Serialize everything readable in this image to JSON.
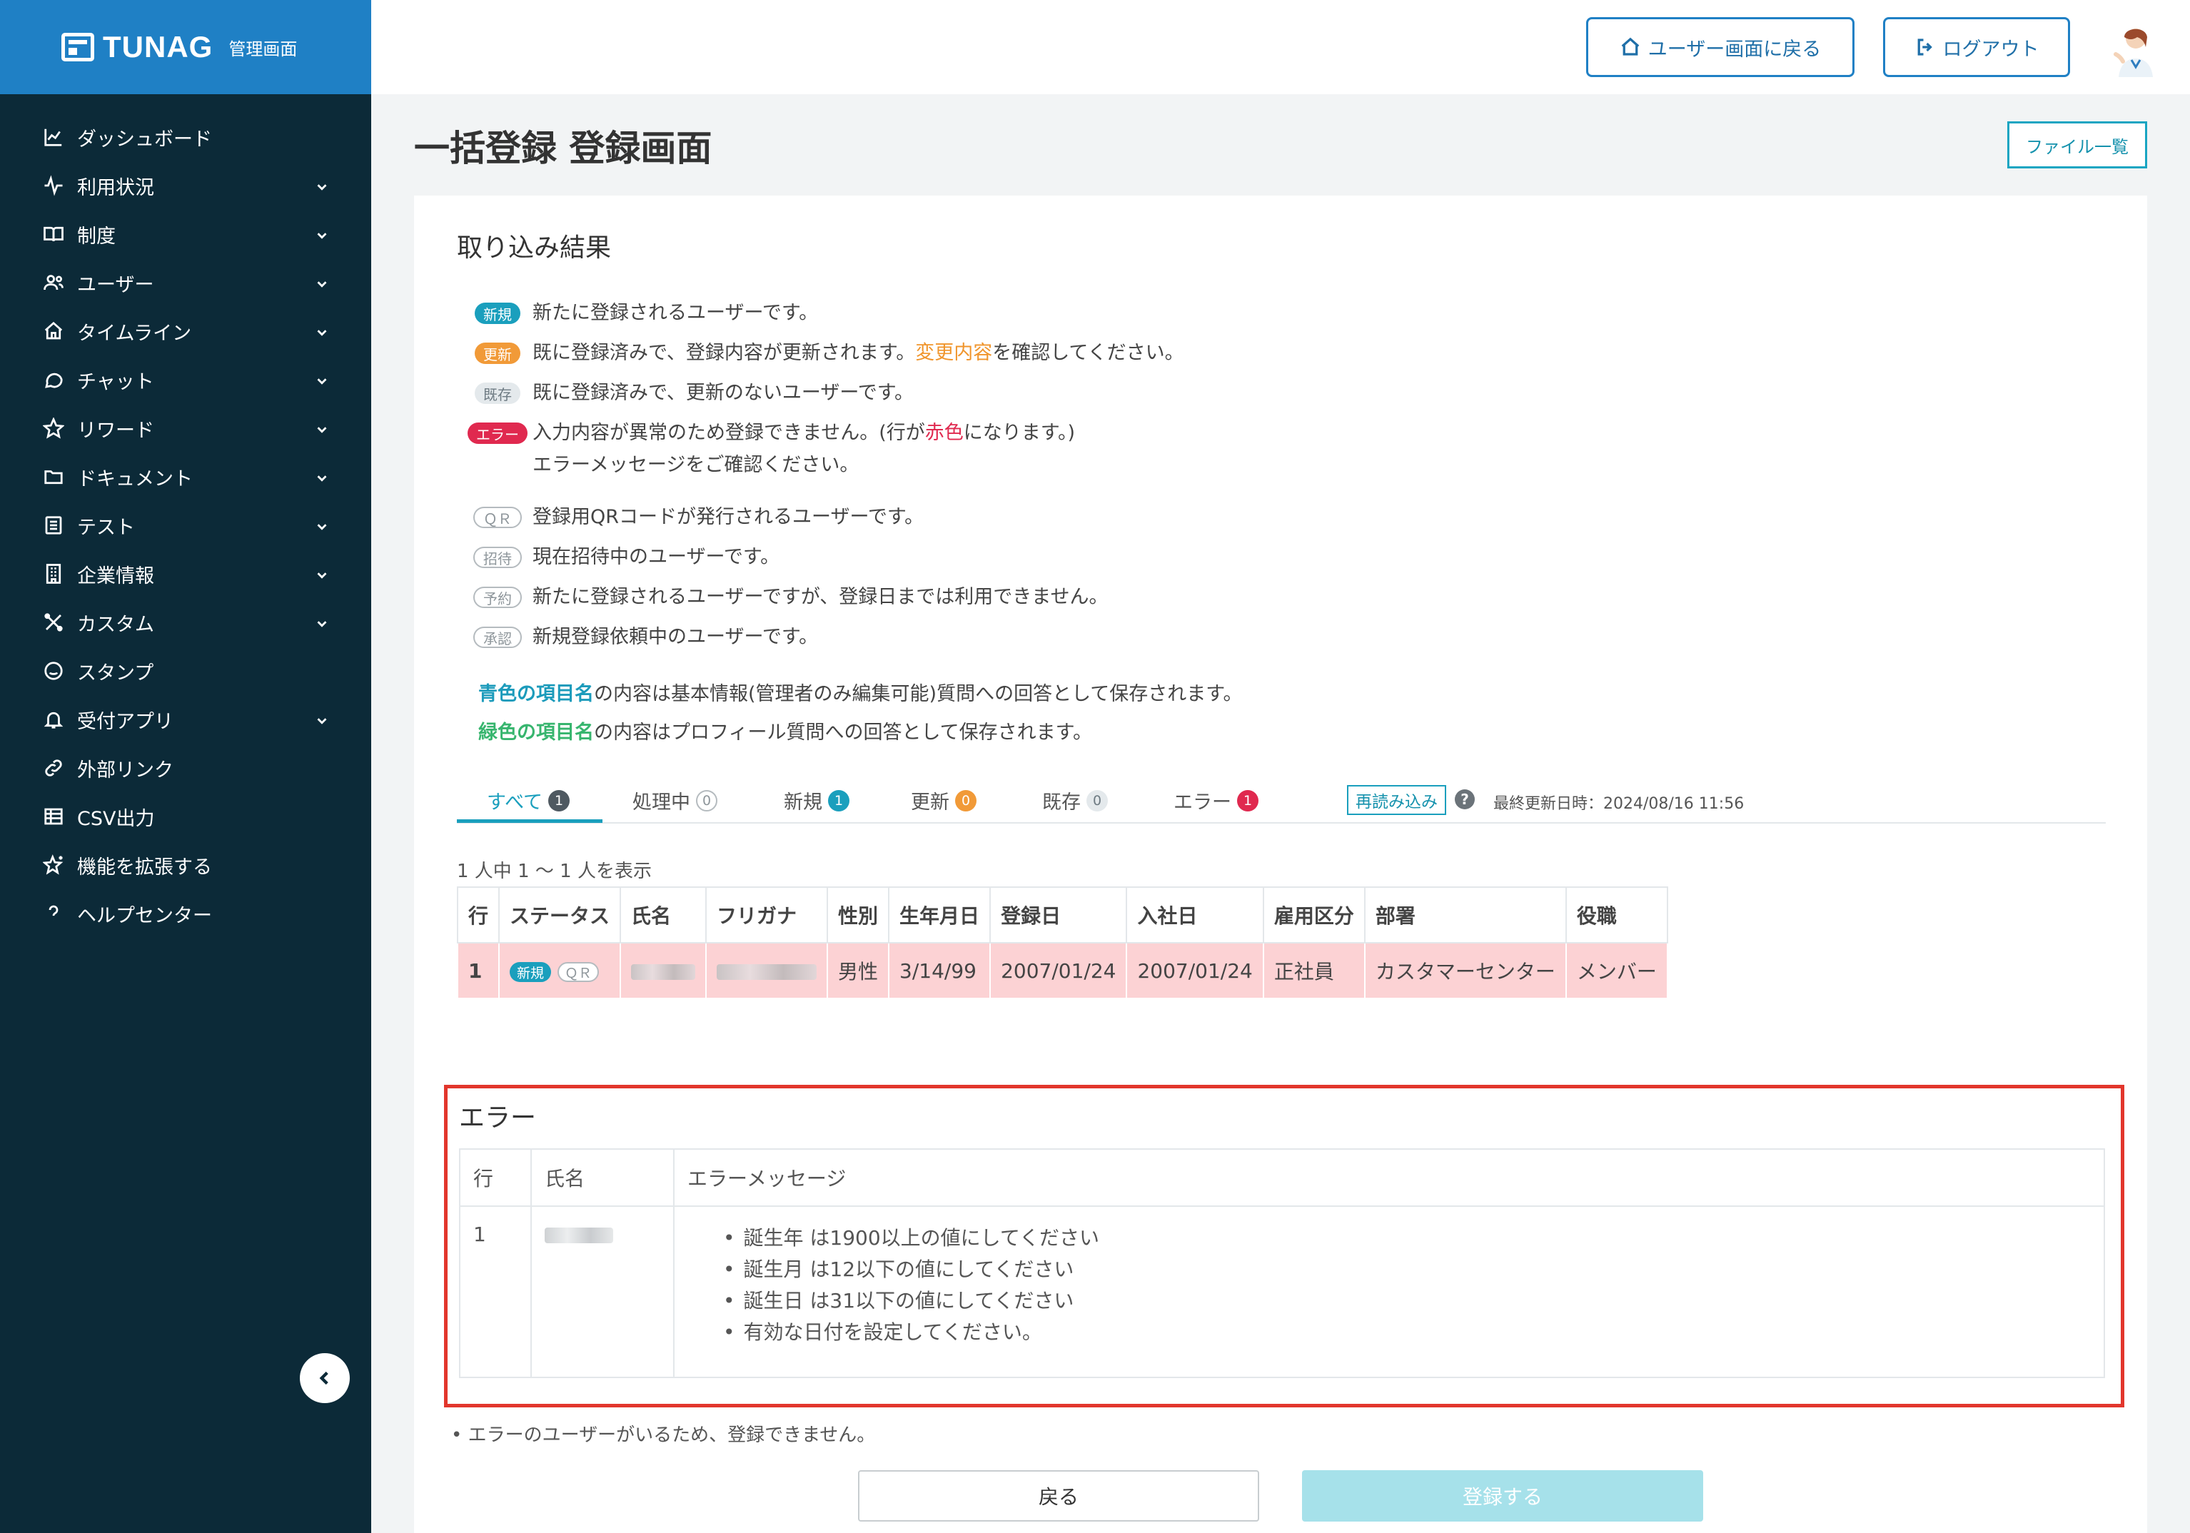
{
  "brand": {
    "logo": "TUNAG",
    "admin_label": "管理画面"
  },
  "sidebar": {
    "items": [
      {
        "label": "ダッシュボード",
        "icon": "chart-icon",
        "expandable": false
      },
      {
        "label": "利用状況",
        "icon": "activity-icon",
        "expandable": true
      },
      {
        "label": "制度",
        "icon": "book-icon",
        "expandable": true
      },
      {
        "label": "ユーザー",
        "icon": "users-icon",
        "expandable": true
      },
      {
        "label": "タイムライン",
        "icon": "home-icon",
        "expandable": true
      },
      {
        "label": "チャット",
        "icon": "chat-icon",
        "expandable": true
      },
      {
        "label": "リワード",
        "icon": "star-icon",
        "expandable": true
      },
      {
        "label": "ドキュメント",
        "icon": "folder-icon",
        "expandable": true
      },
      {
        "label": "テスト",
        "icon": "list-icon",
        "expandable": true
      },
      {
        "label": "企業情報",
        "icon": "building-icon",
        "expandable": true
      },
      {
        "label": "カスタム",
        "icon": "tools-icon",
        "expandable": true
      },
      {
        "label": "スタンプ",
        "icon": "smile-icon",
        "expandable": false
      },
      {
        "label": "受付アプリ",
        "icon": "bell-icon",
        "expandable": true
      },
      {
        "label": "外部リンク",
        "icon": "link-icon",
        "expandable": false
      },
      {
        "label": "CSV出力",
        "icon": "table-icon",
        "expandable": false
      },
      {
        "label": "機能を拡張する",
        "icon": "sparkle-star-icon",
        "expandable": false
      },
      {
        "label": "ヘルプセンター",
        "icon": "question-icon",
        "expandable": false
      }
    ]
  },
  "header": {
    "user_screen_label": "ユーザー画面に戻る",
    "logout_label": "ログアウト"
  },
  "page": {
    "title": "一括登録 登録画面",
    "file_list_label": "ファイル一覧"
  },
  "result": {
    "title": "取り込み結果",
    "legend": {
      "new_badge": "新規",
      "new_text": "新たに登録されるユーザーです。",
      "update_badge": "更新",
      "update_text_1": "既に登録済みで、登録内容が更新されます。",
      "update_text_highlight": "変更内容",
      "update_text_2": "を確認してください。",
      "exist_badge": "既存",
      "exist_text": "既に登録済みで、更新のないユーザーです。",
      "error_badge": "エラー",
      "error_text_1": "入力内容が異常のため登録できません。(行が",
      "error_text_highlight": "赤色",
      "error_text_2": "になります。)",
      "error_text_3": "エラーメッセージをご確認ください。",
      "qr_badge": "ＱＲ",
      "qr_text": "登録用QRコードが発行されるユーザーです。",
      "invite_badge": "招待",
      "invite_text": "現在招待中のユーザーです。",
      "reserve_badge": "予約",
      "reserve_text": "新たに登録されるユーザーですが、登録日までは利用できません。",
      "approve_badge": "承認",
      "approve_text": "新規登録依頼中のユーザーです。",
      "blue_highlight": "青色の項目名",
      "blue_text": "の内容は基本情報(管理者のみ編集可能)質問への回答として保存されます。",
      "green_highlight": "緑色の項目名",
      "green_text": "の内容はプロフィール質問への回答として保存されます。"
    },
    "tabs": [
      {
        "label": "すべて",
        "count": "1"
      },
      {
        "label": "処理中",
        "count": "0"
      },
      {
        "label": "新規",
        "count": "1"
      },
      {
        "label": "更新",
        "count": "0"
      },
      {
        "label": "既存",
        "count": "0"
      },
      {
        "label": "エラー",
        "count": "1"
      }
    ],
    "reload_label": "再読み込み",
    "last_updated": "最終更新日時：2024/08/16 11:56",
    "count_text": "1 人中 1 〜 1 人を表示",
    "table": {
      "headers": [
        "行",
        "ステータス",
        "氏名",
        "フリガナ",
        "性別",
        "生年月日",
        "登録日",
        "入社日",
        "雇用区分",
        "部署",
        "役職"
      ],
      "row": {
        "line": "1",
        "status_new": "新規",
        "status_qr": "ＱＲ",
        "gender": "男性",
        "birth": "3/14/99",
        "registered": "2007/01/24",
        "joined": "2007/01/24",
        "employment": "正社員",
        "department": "カスタマーセンター",
        "position": "メンバー"
      }
    }
  },
  "errors": {
    "title": "エラー",
    "headers": {
      "line": "行",
      "name": "氏名",
      "message": "エラーメッセージ"
    },
    "row": {
      "line": "1",
      "messages": [
        "誕生年 は1900以上の値にしてください",
        "誕生月 は12以下の値にしてください",
        "誕生日 は31以下の値にしてください",
        "有効な日付を設定してください。"
      ]
    }
  },
  "footer": {
    "notice": "• エラーのユーザーがいるため、登録できません。",
    "back_label": "戻る",
    "register_label": "登録する"
  }
}
